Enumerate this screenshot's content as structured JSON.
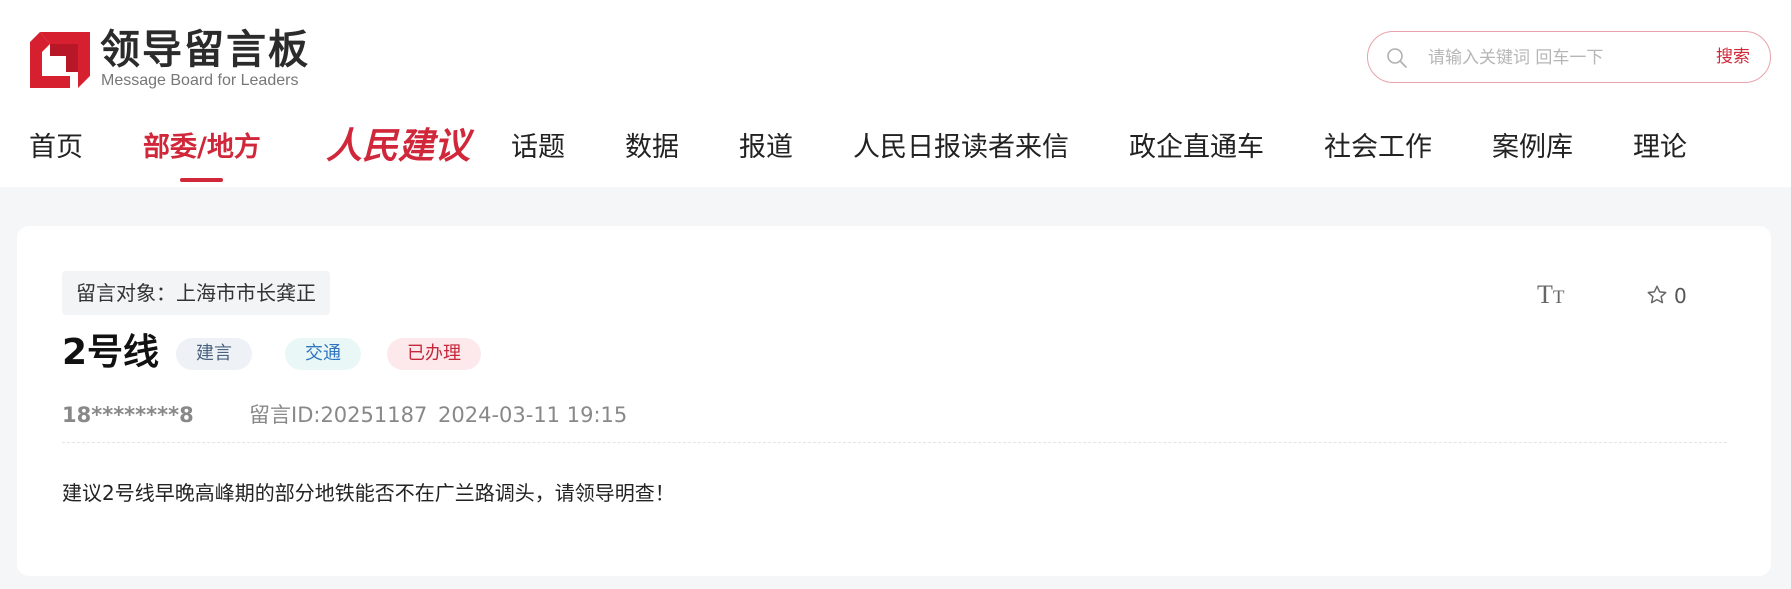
{
  "header": {
    "logo_title": "领导留言板",
    "logo_subtitle": "Message Board for Leaders",
    "search": {
      "placeholder": "请输入关键词 回车一下",
      "button_label": "搜索"
    }
  },
  "nav": {
    "items": [
      {
        "label": "首页"
      },
      {
        "label": "部委/地方",
        "active": true
      },
      {
        "label": "人民建议",
        "special": true
      },
      {
        "label": "话题"
      },
      {
        "label": "数据"
      },
      {
        "label": "报道"
      },
      {
        "label": "人民日报读者来信"
      },
      {
        "label": "政企直通车"
      },
      {
        "label": "社会工作"
      },
      {
        "label": "案例库"
      },
      {
        "label": "理论"
      }
    ]
  },
  "message": {
    "target_label": "留言对象：上海市市长龚正",
    "title": "2号线",
    "badges": {
      "type": "建言",
      "category": "交通",
      "status": "已办理"
    },
    "font_tool": {
      "big": "T",
      "small": "T"
    },
    "favorite_count": "0",
    "user": "18********8",
    "message_id": "留言ID:20251187",
    "time": "2024-03-11 19:15",
    "content": "建议2号线早晚高峰期的部分地铁能否不在广兰路调头，请领导明查！"
  },
  "colors": {
    "accent": "#d0283a",
    "page_bg": "#f5f6f8"
  }
}
